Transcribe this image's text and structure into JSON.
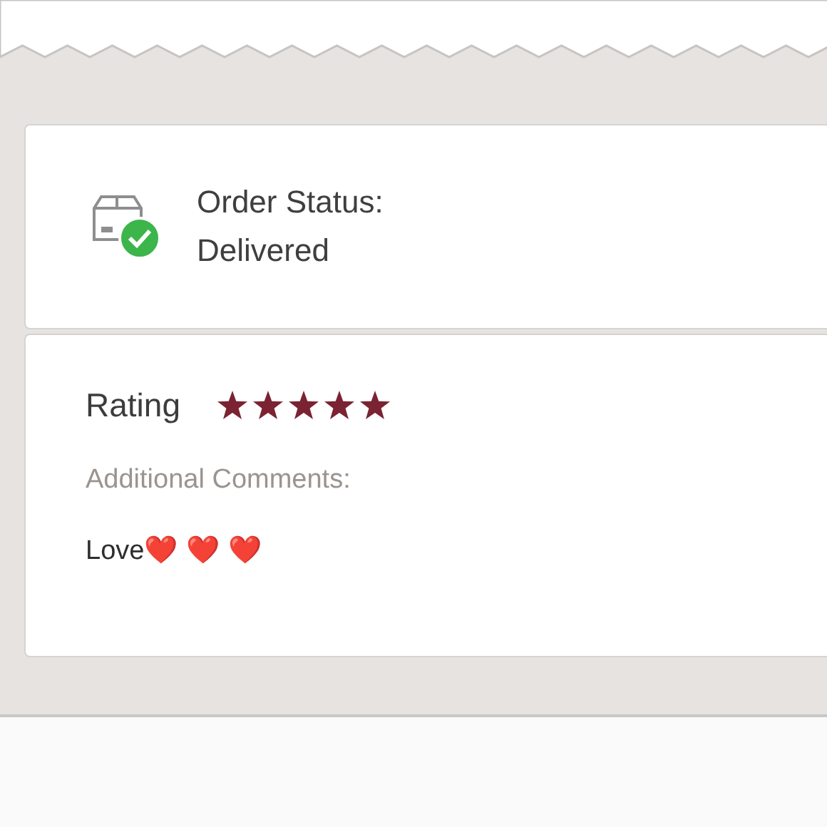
{
  "order_status": {
    "label": "Order Status:",
    "value": "Delivered",
    "delivered": true
  },
  "rating": {
    "label": "Rating",
    "stars": 5
  },
  "comments": {
    "label": "Additional Comments:",
    "text": "Love❤️ ❤️ ❤️"
  }
}
